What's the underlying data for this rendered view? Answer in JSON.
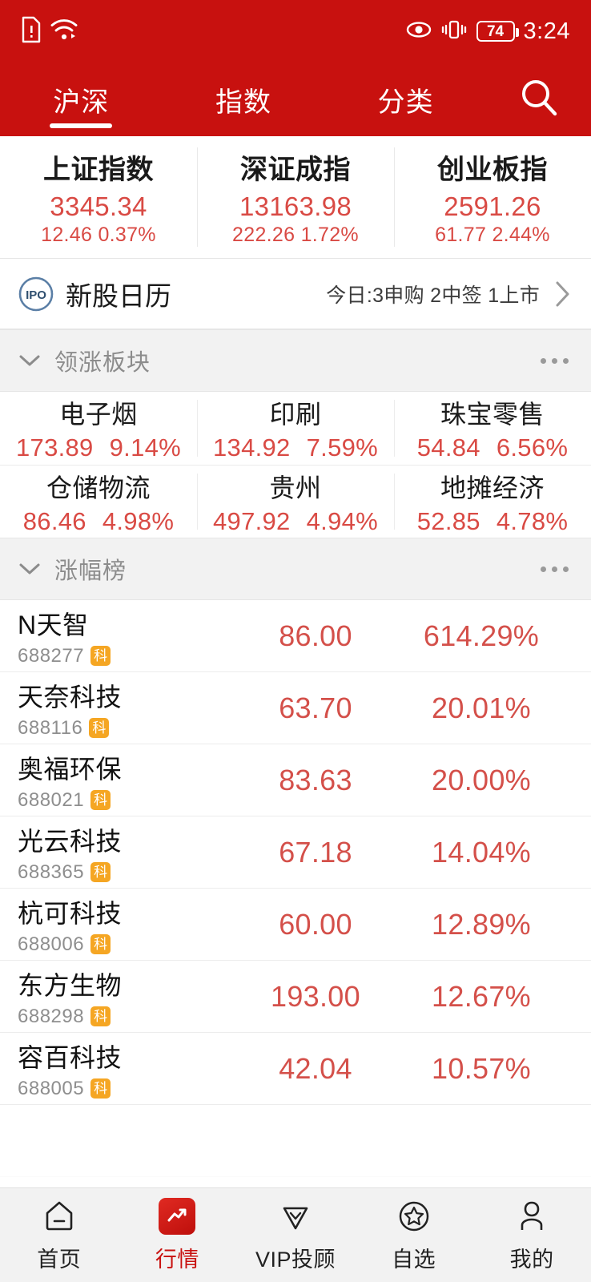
{
  "statusbar": {
    "icons": [
      "sim-alert-icon",
      "wifi-icon",
      "eye-icon",
      "vibrate-icon"
    ],
    "battery_level": "74",
    "time": "3:24"
  },
  "header": {
    "brand_color": "#C8110F",
    "tabs": [
      {
        "label": "沪深",
        "active": true
      },
      {
        "label": "指数",
        "active": false
      },
      {
        "label": "分类",
        "active": false
      }
    ],
    "search_icon": "search-icon"
  },
  "indices": [
    {
      "name": "上证指数",
      "value": "3345.34",
      "change": "12.46",
      "pct": "0.37%"
    },
    {
      "name": "深证成指",
      "value": "13163.98",
      "change": "222.26",
      "pct": "1.72%"
    },
    {
      "name": "创业板指",
      "value": "2591.26",
      "change": "61.77",
      "pct": "2.44%"
    }
  ],
  "ipo": {
    "icon": "ipo-icon",
    "title": "新股日历",
    "meta": "今日:3申购  2中签  1上市",
    "chevron": "chevron-right-icon"
  },
  "sectors_section": {
    "title": "领涨板块",
    "collapse_icon": "chevron-down-icon",
    "more_icon": "more-icon"
  },
  "sectors": [
    {
      "name": "电子烟",
      "price": "173.89",
      "pct": "9.14%"
    },
    {
      "name": "印刷",
      "price": "134.92",
      "pct": "7.59%"
    },
    {
      "name": "珠宝零售",
      "price": "54.84",
      "pct": "6.56%"
    },
    {
      "name": "仓储物流",
      "price": "86.46",
      "pct": "4.98%"
    },
    {
      "name": "贵州",
      "price": "497.92",
      "pct": "4.94%"
    },
    {
      "name": "地摊经济",
      "price": "52.85",
      "pct": "4.78%"
    }
  ],
  "gainers_section": {
    "title": "涨幅榜",
    "collapse_icon": "chevron-down-icon",
    "more_icon": "more-icon"
  },
  "gainers": [
    {
      "name": "N天智",
      "code": "688277",
      "badge": "科",
      "price": "86.00",
      "pct": "614.29%"
    },
    {
      "name": "天奈科技",
      "code": "688116",
      "badge": "科",
      "price": "63.70",
      "pct": "20.01%"
    },
    {
      "name": "奥福环保",
      "code": "688021",
      "badge": "科",
      "price": "83.63",
      "pct": "20.00%"
    },
    {
      "name": "光云科技",
      "code": "688365",
      "badge": "科",
      "price": "67.18",
      "pct": "14.04%"
    },
    {
      "name": "杭可科技",
      "code": "688006",
      "badge": "科",
      "price": "60.00",
      "pct": "12.89%"
    },
    {
      "name": "东方生物",
      "code": "688298",
      "badge": "科",
      "price": "193.00",
      "pct": "12.67%"
    },
    {
      "name": "容百科技",
      "code": "688005",
      "badge": "科",
      "price": "42.04",
      "pct": "10.57%"
    }
  ],
  "bottom_nav": [
    {
      "label": "首页",
      "icon": "home-icon",
      "active": false
    },
    {
      "label": "行情",
      "icon": "quotes-icon",
      "active": true
    },
    {
      "label": "VIP投顾",
      "icon": "vip-icon",
      "active": false
    },
    {
      "label": "自选",
      "icon": "star-icon",
      "active": false
    },
    {
      "label": "我的",
      "icon": "person-icon",
      "active": false
    }
  ],
  "colors": {
    "brand_red": "#C8110F",
    "up_red": "#D4504A",
    "badge_orange": "#F5A623",
    "section_bg": "#F2F2F2"
  }
}
